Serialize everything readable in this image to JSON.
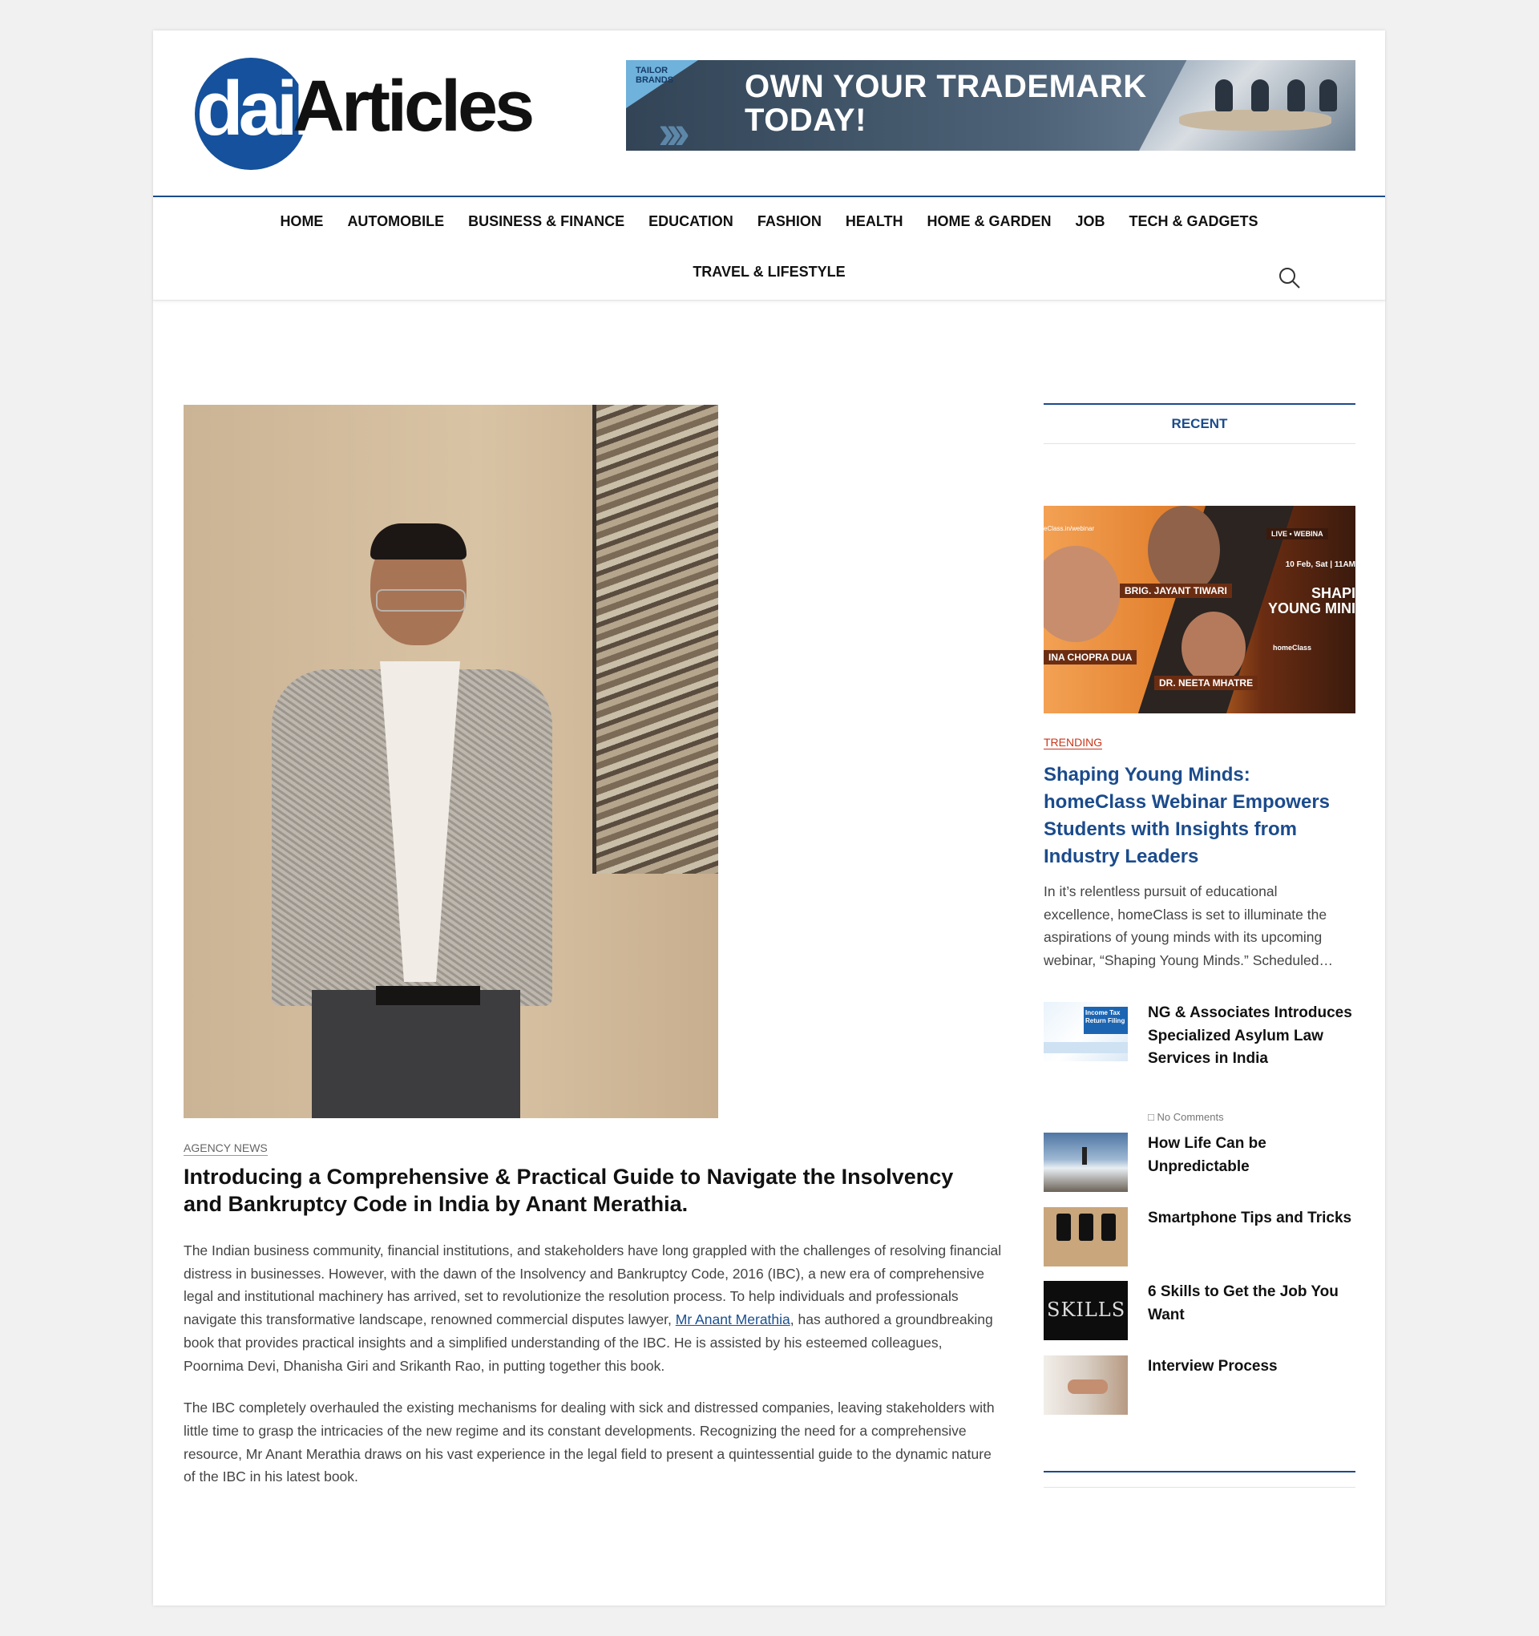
{
  "header": {
    "logo": {
      "part1": "daily",
      "part2": "Articles"
    },
    "ad": {
      "brand": "TAILOR BRANDS",
      "headline_line1": "OWN YOUR TRADEMARK",
      "headline_line2": "TODAY!"
    }
  },
  "nav": {
    "row1": [
      "HOME",
      "AUTOMOBILE",
      "BUSINESS & FINANCE",
      "EDUCATION",
      "FASHION",
      "HEALTH",
      "HOME & GARDEN",
      "JOB",
      "TECH & GADGETS"
    ],
    "row2": [
      "TRAVEL & LIFESTYLE"
    ],
    "search_icon": "search-icon"
  },
  "article": {
    "category": "AGENCY NEWS",
    "title": "Introducing a Comprehensive & Practical Guide to Navigate the Insolvency and Bankruptcy Code in India by Anant Merathia.",
    "p1_before": "The Indian business community, financial institutions, and stakeholders have long grappled with the challenges of resolving financial distress in businesses. However, with the dawn of the Insolvency and Bankruptcy Code, 2016 (IBC), a new era of comprehensive legal and institutional machinery has arrived, set to revolutionize the resolution process. To help individuals and professionals navigate this transformative landscape, renowned commercial disputes lawyer, ",
    "p1_link": "Mr Anant Merathia",
    "p1_after": ", has authored a groundbreaking book that provides practical insights and a simplified understanding of the IBC. He is assisted by his esteemed colleagues, Poornima Devi, Dhanisha Giri and Srikanth Rao, in putting together this book.",
    "p2": "The IBC completely overhauled the existing mechanisms for dealing with sick and distressed companies, leaving stakeholders with little time to grasp the intricacies of the new regime and its constant developments. Recognizing the need for a comprehensive resource, Mr Anant Merathia draws on his vast experience in the legal field to present a quintessential guide to the dynamic nature of the IBC in his latest book."
  },
  "sidebar": {
    "widget_title": "RECENT",
    "featured": {
      "image": {
        "url_text": "eClass.in/webinar",
        "live": "LIVE • WEBINA",
        "date": "10 Feb, Sat | 11AM",
        "title_line1": "SHAPI",
        "title_line2": "YOUNG MINI",
        "speaker1": "BRIG. JAYANT TIWARI",
        "speaker2": "INA CHOPRA DUA",
        "speaker3": "DR. NEETA MHATRE",
        "brand": "homeClass"
      },
      "tag": "TRENDING",
      "title": "Shaping Young Minds: homeClass Webinar Empowers Students with Insights from Industry Leaders",
      "excerpt_lines": [
        "In it’s relentless pursuit of educational",
        "excellence, homeClass is set to illuminate the",
        "aspirations of young minds with its upcoming",
        "webinar, “Shaping Young Minds.” Scheduled…"
      ]
    },
    "posts": [
      {
        "title": "NG & Associates Introduces Specialized Asylum Law Services in India",
        "meta": "No Comments",
        "thumb_text": "Income Tax Return Filing"
      },
      {
        "title": "How Life Can be Unpredictable"
      },
      {
        "title": "Smartphone Tips and Tricks"
      },
      {
        "title": "6 Skills to Get the Job You Want",
        "thumb_text": "SKILLS"
      },
      {
        "title": "Interview Process"
      }
    ]
  },
  "colors": {
    "brand_blue": "#1b4b8c",
    "logo_blue": "#15519c",
    "trending_red": "#c8361a"
  }
}
